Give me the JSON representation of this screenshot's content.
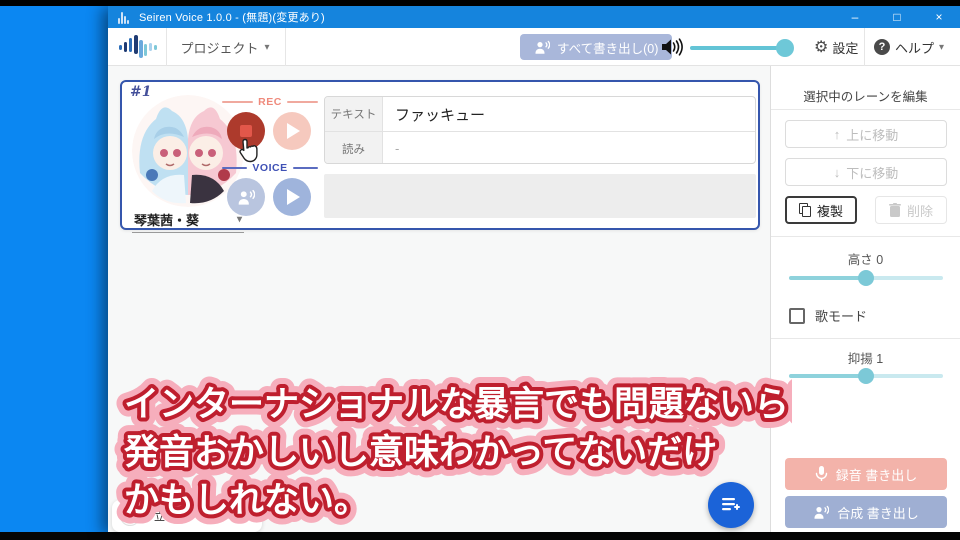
{
  "window": {
    "title": "Seiren Voice 1.0.0 - (無題)(変更あり)",
    "controls": {
      "minimize": "–",
      "maximize": "□",
      "close": "×"
    }
  },
  "toolbar": {
    "project_label": "プロジェクト",
    "export_all_label": "すべて書き出し(0)",
    "settings_label": "設定",
    "help_label": "ヘルプ",
    "volume_percent": 92
  },
  "icons": {
    "caret_down": "▾",
    "gear": "⚙",
    "question": "?",
    "arrow_up": "↑",
    "arrow_down": "↓"
  },
  "lane": {
    "number": "#1",
    "voice_name": "琴葉茜・葵",
    "rec_section_label": "REC",
    "voice_section_label": "VOICE",
    "text_field_label": "テキスト",
    "text_field_value": "ファッキュー",
    "reading_field_label": "読み",
    "reading_field_value": "-"
  },
  "sidebar": {
    "header": "選択中のレーンを編集",
    "move_up_label": "上に移動",
    "move_down_label": "下に移動",
    "duplicate_label": "複製",
    "delete_label": "削除",
    "pitch_label": "高さ 0",
    "pitch_value": 0,
    "song_mode_label": "歌モード",
    "song_mode_checked": false,
    "intonation_label": "抑揚 1",
    "intonation_value": 1,
    "record_export_label": "録音 書き出し",
    "synth_export_label": "合成 書き出し"
  },
  "subtitle": {
    "lines": [
      "インターナショナルな暴言でも問題ないらしい。",
      "発音おかしいし意味わかってないだけ",
      "かもしれない。"
    ]
  },
  "partial_card": {
    "text": "立"
  },
  "colors": {
    "titlebar": "#1584dd",
    "desktop": "#0b87f2",
    "accent_teal": "#6ec8d8",
    "lane_border": "#3556ad",
    "rec_red": "#ad3a2c",
    "rec_pink": "#f6c9be",
    "voice_blue": "#9fb4dc",
    "export_all_bg": "#a9b7da",
    "record_export_bg": "#f3b3aa",
    "synth_export_bg": "#9fafd3",
    "fab_blue": "#1b63d8",
    "subtitle_stroke": "#bf1f2e"
  }
}
